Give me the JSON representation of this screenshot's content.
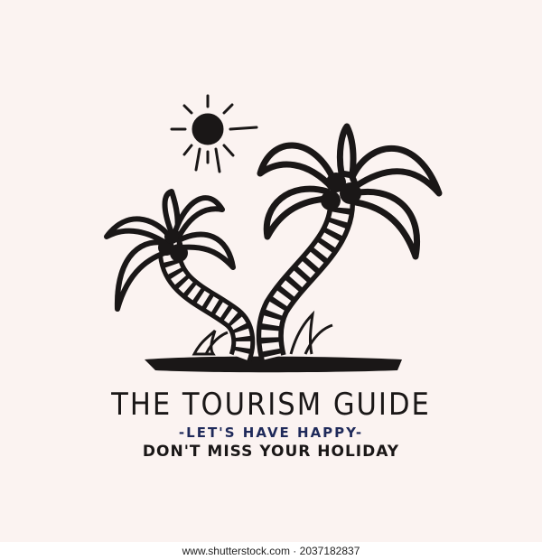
{
  "logo": {
    "title": "THE TOURISM GUIDE",
    "tagline": "-LET'S HAVE HAPPY-",
    "subline": "DON'T MISS YOUR HOLIDAY"
  },
  "watermark": {
    "text": "www.shutterstock.com · 2037182837"
  },
  "colors": {
    "background": "#fbf3f1",
    "ink": "#1a1717",
    "tagline": "#1f2a5a"
  },
  "icons": [
    "sun-icon",
    "palm-tree-icon",
    "island-icon"
  ]
}
